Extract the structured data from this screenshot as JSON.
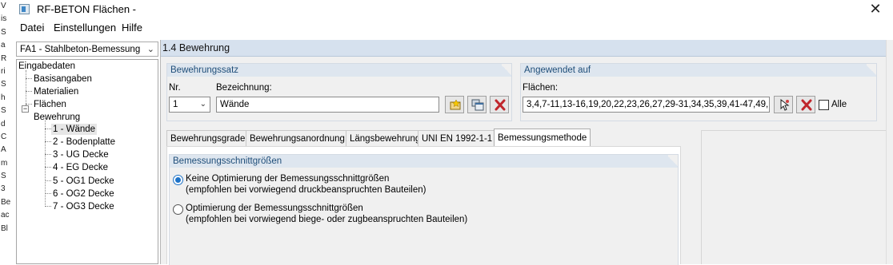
{
  "background_window": {
    "row_letters": [
      "V",
      "is",
      "S",
      "a",
      "R",
      "ri",
      "S",
      "h",
      "S",
      "d",
      "C",
      "A",
      "m",
      "S",
      "3",
      "Be",
      "ac",
      "Bl"
    ]
  },
  "window": {
    "title": "RF-BETON Flächen -",
    "close_glyph": "✕"
  },
  "menu": [
    "Datei",
    "Einstellungen",
    "Hilfe"
  ],
  "module_select": {
    "value": "FA1 - Stahlbeton-Bemessung"
  },
  "tree": {
    "root": "Eingabedaten",
    "items": [
      "Basisangaben",
      "Materialien",
      "Flächen",
      "Bewehrung"
    ],
    "bewehrung_children": [
      "1 - Wände",
      "2 - Bodenplatte",
      "3 - UG Decke",
      "4 - EG Decke",
      "5 - OG1 Decke",
      "6 - OG2 Decke",
      "7 - OG3 Decke"
    ],
    "selected": "1 - Wände"
  },
  "header": {
    "title": "1.4 Bewehrung"
  },
  "bewehrungssatz": {
    "title": "Bewehrungssatz",
    "nr_label": "Nr.",
    "nr_value": "1",
    "bezeichnung_label": "Bezeichnung:",
    "bezeichnung_value": "Wände"
  },
  "angewendet": {
    "title": "Angewendet auf",
    "flaechen_label": "Flächen:",
    "flaechen_value": "3,4,7-11,13-16,19,20,22,23,26,27,29-31,34,35,39,41-47,49,",
    "alle_label": "Alle",
    "alle_checked": false
  },
  "tabs": [
    "Bewehrungsgrade",
    "Bewehrungsanordnung",
    "Längsbewehrung",
    "UNI EN 1992-1-1",
    "Bemessungsmethode"
  ],
  "active_tab": "Bemessungsmethode",
  "bemessung": {
    "title": "Bemessungsschnittgrößen",
    "option1_line1": "Keine Optimierung der Bemessungsschnittgrößen",
    "option1_line2": "(empfohlen bei vorwiegend druckbeanspruchten Bauteilen)",
    "option2_line1": "Optimierung der Bemessungsschnittgrößen",
    "option2_line2": "(empfohlen bei vorwiegend biege- oder zugbeanspruchten Bauteilen)",
    "selected_option": 1
  },
  "colors": {
    "accent": "#1e73c8",
    "header_bg": "#d6e1ee",
    "group_title": "#1f4e79",
    "delete_red": "#c0262c"
  }
}
